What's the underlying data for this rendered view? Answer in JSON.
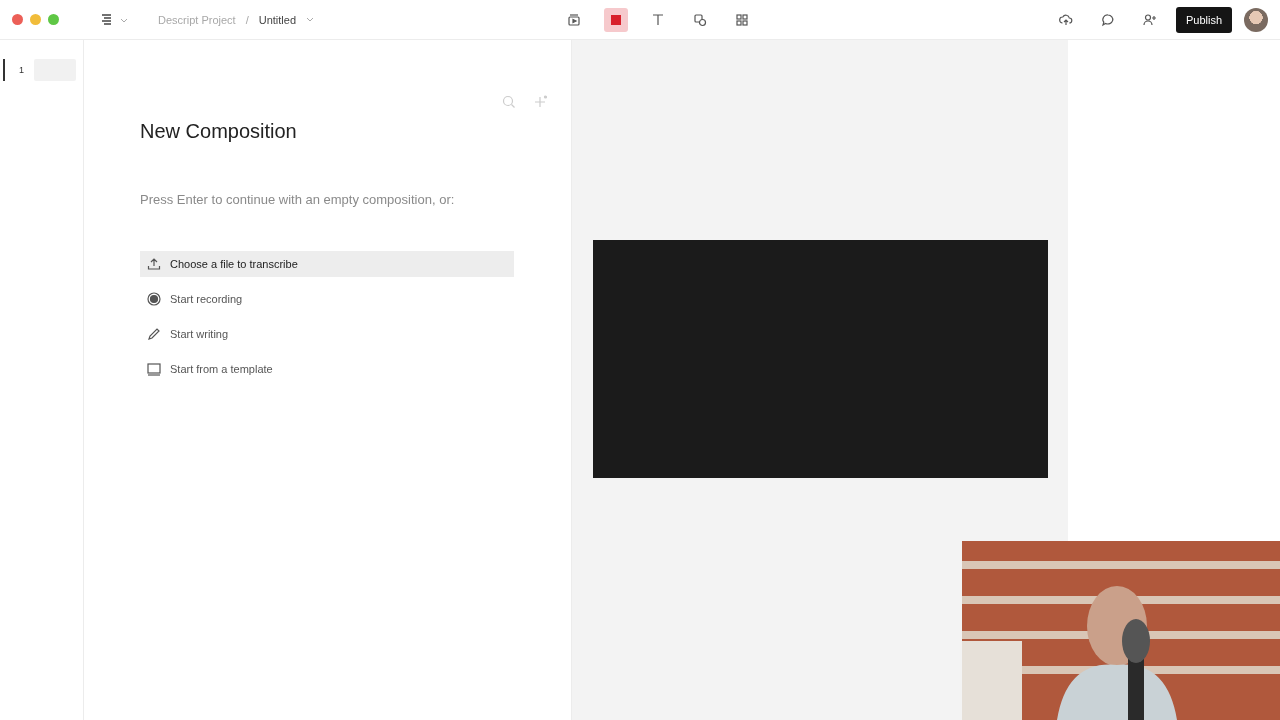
{
  "breadcrumb": {
    "project": "Descript Project",
    "separator": "/",
    "document": "Untitled"
  },
  "tools": [
    {
      "kind": "scene",
      "selected": false
    },
    {
      "kind": "record",
      "selected": true
    },
    {
      "kind": "text",
      "selected": false
    },
    {
      "kind": "shape",
      "selected": false
    },
    {
      "kind": "grid",
      "selected": false
    }
  ],
  "actions": {
    "publish": "Publish"
  },
  "scenes": [
    {
      "number": "1",
      "selected": true
    }
  ],
  "composition": {
    "title": "New Composition",
    "hint": "Press Enter to continue with an empty composition, or:",
    "options": [
      {
        "kind": "upload",
        "label": "Choose a file to transcribe",
        "selected": true
      },
      {
        "kind": "record",
        "label": "Start recording",
        "selected": false
      },
      {
        "kind": "write",
        "label": "Start writing",
        "selected": false
      },
      {
        "kind": "template",
        "label": "Start from a template",
        "selected": false
      }
    ]
  }
}
